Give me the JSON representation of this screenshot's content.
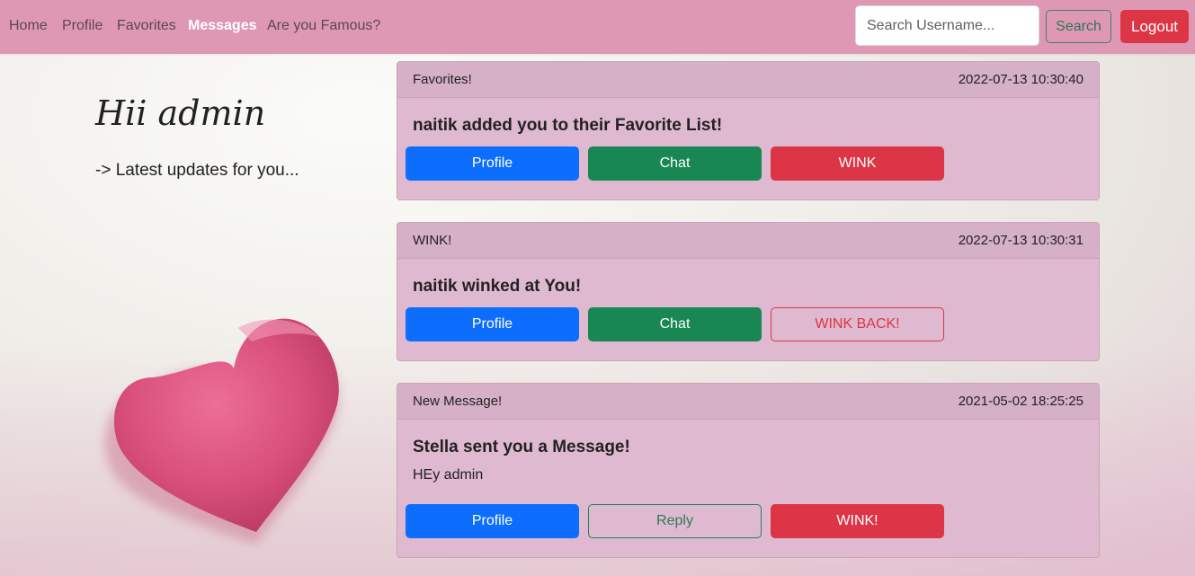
{
  "nav": {
    "links": [
      "Home",
      "Profile",
      "Favorites",
      "Messages",
      "Are you Famous?"
    ],
    "search_placeholder": "Search Username...",
    "search_label": "Search",
    "logout_label": "Logout"
  },
  "greeting": {
    "title": "Hii admin",
    "subtitle": "-> Latest updates for you..."
  },
  "cards": [
    {
      "header": "Favorites!",
      "timestamp": "2022-07-13 10:30:40",
      "title": "naitik added you to their Favorite List!",
      "text": "",
      "buttons": [
        "Profile",
        "Chat",
        "WINK"
      ]
    },
    {
      "header": "WINK!",
      "timestamp": "2022-07-13 10:30:31",
      "title": "naitik winked at You!",
      "text": "",
      "buttons": [
        "Profile",
        "Chat",
        "WINK BACK!"
      ]
    },
    {
      "header": "New Message!",
      "timestamp": "2021-05-02 18:25:25",
      "title": "Stella sent you a Message!",
      "text": "HEy admin",
      "buttons": [
        "Profile",
        "Reply",
        "WINK!"
      ]
    }
  ],
  "colors": {
    "navbar": "#df98b4",
    "card": "#dfb9cf",
    "primary": "#0d6efd",
    "success": "#198754",
    "danger": "#dc3545",
    "heart": "#d94f7c"
  }
}
